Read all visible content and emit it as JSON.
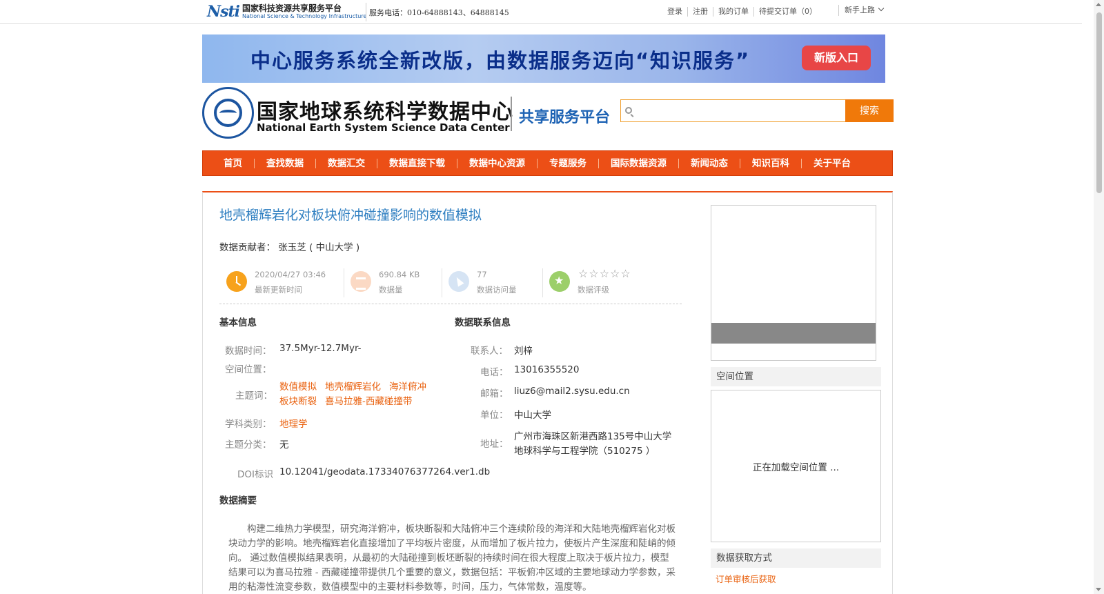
{
  "topbar": {
    "logo_mark": "Nsti",
    "logo_cn": "国家科技资源共享服务平台",
    "logo_en": "National Science & Technology Infrastructure",
    "phone": "服务电话：010-64888143、64888145",
    "links": [
      "登录",
      "注册",
      "我的订单",
      "待提交订单（0）"
    ],
    "newbie": "新手上路"
  },
  "banner": {
    "text": "中心服务系统全新改版，由数据服务迈向“知识服务”",
    "button": "新版入口"
  },
  "header": {
    "center_cn": "国家地球系统科学数据中心",
    "center_en": "National Earth System Science Data Center",
    "platform": "共享服务平台",
    "search_placeholder": "",
    "search_button": "搜索"
  },
  "nav": [
    "首页",
    "查找数据",
    "数据汇交",
    "数据直接下载",
    "数据中心资源",
    "专题服务",
    "国际数据资源",
    "新闻动态",
    "知识百科",
    "关于平台"
  ],
  "dataset": {
    "title": "地壳榴辉岩化对板块俯冲碰撞影响的数值模拟",
    "contributor_label": "数据贡献者：",
    "contributor": "张玉芝 ( 中山大学 )",
    "stats": [
      {
        "value": "2020/04/27 03:46",
        "label": "最新更新时间",
        "icon": "clock-icon"
      },
      {
        "value": "690.84 KB",
        "label": "数据量",
        "icon": "layers-icon"
      },
      {
        "value": "77",
        "label": "数据访问量",
        "icon": "cursor-icon"
      },
      {
        "value": "☆☆☆☆☆",
        "label": "数据评级",
        "icon": "star-icon"
      }
    ]
  },
  "basic_info": {
    "heading": "基本信息",
    "time_label": "数据时间：",
    "time_value": "37.5Myr-12.7Myr-",
    "space_label": "空间位置：",
    "keywords_label": "主题词：",
    "keywords": [
      "数值模拟",
      "地壳榴辉岩化",
      "海洋俯冲",
      "板块断裂",
      "喜马拉雅-西藏碰撞带"
    ],
    "discipline_label": "学科类别：",
    "discipline": "地理学",
    "category_label": "主题分类：",
    "category": "无",
    "doi_label": "DOI标识",
    "doi": "10.12041/geodata.17334076377264.ver1.db"
  },
  "contact_info": {
    "heading": "数据联系信息",
    "person_label": "联系人：",
    "person": "刘梓",
    "phone_label": "电话：",
    "phone": "13016355520",
    "email_label": "邮箱：",
    "email": "liuz6@mail2.sysu.edu.cn",
    "unit_label": "单位：",
    "unit": "中山大学",
    "address_label": "地址：",
    "address_line1": "广州市海珠区新港西路135号中山大学",
    "address_line2": "地球科学与工程学院（510275 ）"
  },
  "abstract": {
    "heading": "数据摘要",
    "text": "构建二维热力学模型，研究海洋俯冲，板块断裂和大陆俯冲三个连续阶段的海洋和大陆地壳榴辉岩化对板块动力学的影响。地壳榴辉岩化直接增加了平均板片密度，从而增加了板片拉力，使板片产生深度和陡峭的倾向。 通过数值模拟结果表明，从最初的大陆碰撞到板坯断裂的持续时间在很大程度上取决于板片拉力，模型结果可以为喜马拉雅 - 西藏碰撞带提供几个重要的意义，数据包括：平板俯冲区域的主要地球动力学参数，采用的粘滞性流变参数，数值模型中的主要材料参数等，时间，压力，气体常数，温度等。"
  },
  "sidebar": {
    "space_heading": "空间位置",
    "map_loading": "正在加载空间位置 ...",
    "access_heading": "数据获取方式",
    "access_link": "订单审核后获取"
  }
}
